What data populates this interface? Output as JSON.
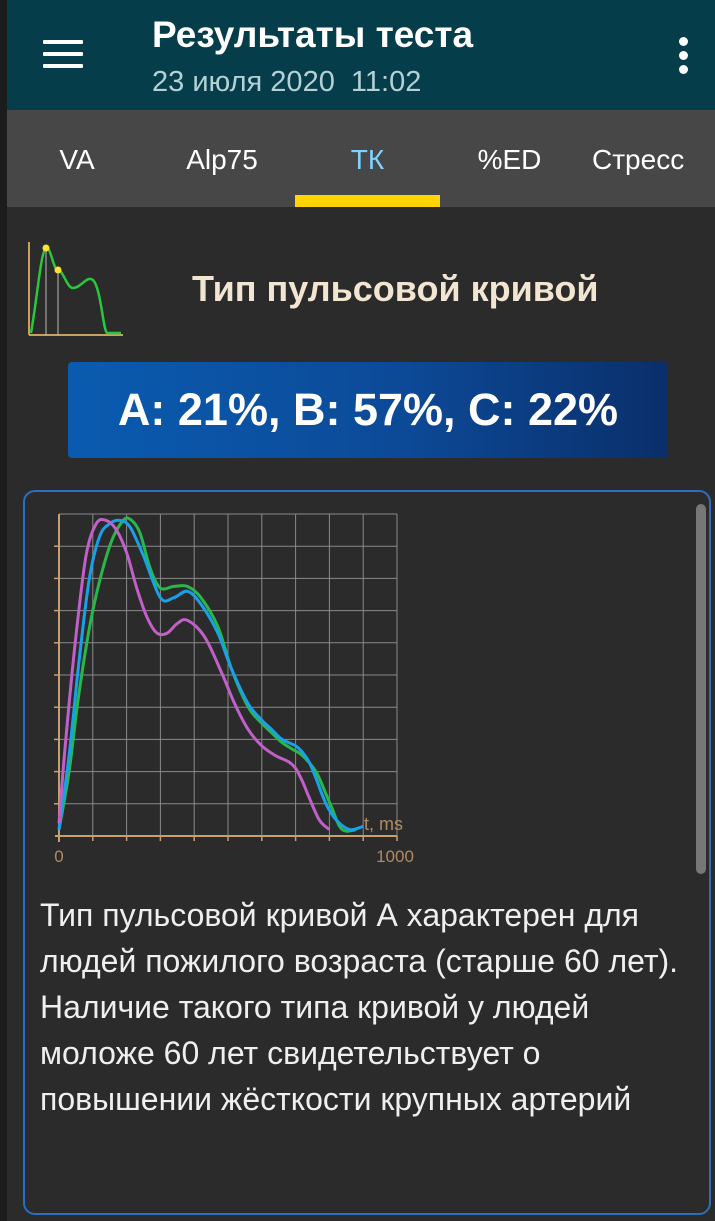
{
  "header": {
    "menu_icon": "hamburger-menu-icon",
    "title": "Результаты теста",
    "subtitle": "23 июля 2020  11:02",
    "more_icon": "more-vertical-icon"
  },
  "tabs": [
    {
      "label": "VA",
      "active": false
    },
    {
      "label": "Alp75",
      "active": false
    },
    {
      "label": "ТК",
      "active": true
    },
    {
      "label": "%ED",
      "active": false
    },
    {
      "label": "Стресс",
      "active": false
    }
  ],
  "section": {
    "icon": "pulse-curve-icon",
    "title": "Тип пульсовой кривой",
    "result": "A: 21%, B: 57%, C: 22%"
  },
  "card": {
    "description": "Тип пульсовой кривой А характерен для людей пожилого возраста (старше 60 лет). Наличие такого типа кривой у людей моложе 60 лет свидетельствует о повышении жёсткости крупных артерий"
  },
  "chart_data": {
    "type": "line",
    "xlabel": "t, ms",
    "ylabel": "",
    "xlim": [
      0,
      1000
    ],
    "ylim": [
      0,
      1
    ],
    "x_tick_labels": [
      "0",
      "1000"
    ],
    "grid": true,
    "colors": [
      "#28b84a",
      "#1aa0e8",
      "#c060c8"
    ],
    "series": [
      {
        "color": "#28b84a",
        "x": [
          0,
          30,
          60,
          100,
          150,
          190,
          215,
          240,
          270,
          300,
          340,
          380,
          420,
          470,
          510,
          560,
          600,
          630,
          660,
          690,
          720,
          760,
          790,
          810,
          830,
          850,
          880
        ],
        "y": [
          0.02,
          0.2,
          0.45,
          0.7,
          0.9,
          0.98,
          0.98,
          0.94,
          0.83,
          0.77,
          0.775,
          0.775,
          0.74,
          0.65,
          0.52,
          0.4,
          0.35,
          0.32,
          0.29,
          0.27,
          0.25,
          0.2,
          0.13,
          0.08,
          0.03,
          0.015,
          0.02
        ]
      },
      {
        "color": "#1aa0e8",
        "x": [
          0,
          30,
          60,
          90,
          120,
          150,
          180,
          210,
          250,
          300,
          340,
          380,
          420,
          470,
          510,
          560,
          600,
          630,
          660,
          700,
          720,
          740,
          760,
          790,
          820,
          860,
          900
        ],
        "y": [
          0.02,
          0.25,
          0.55,
          0.8,
          0.93,
          0.97,
          0.98,
          0.96,
          0.87,
          0.74,
          0.74,
          0.76,
          0.72,
          0.63,
          0.52,
          0.41,
          0.36,
          0.33,
          0.3,
          0.28,
          0.26,
          0.23,
          0.18,
          0.1,
          0.05,
          0.02,
          0.03
        ]
      },
      {
        "color": "#c060c8",
        "x": [
          0,
          20,
          50,
          80,
          110,
          140,
          170,
          200,
          230,
          260,
          290,
          320,
          350,
          380,
          430,
          480,
          520,
          560,
          600,
          640,
          680,
          700,
          720,
          740,
          770,
          800
        ],
        "y": [
          0.04,
          0.3,
          0.62,
          0.87,
          0.97,
          0.98,
          0.95,
          0.88,
          0.77,
          0.68,
          0.63,
          0.63,
          0.66,
          0.67,
          0.62,
          0.51,
          0.41,
          0.33,
          0.28,
          0.25,
          0.23,
          0.21,
          0.17,
          0.12,
          0.05,
          0.02
        ]
      }
    ]
  }
}
